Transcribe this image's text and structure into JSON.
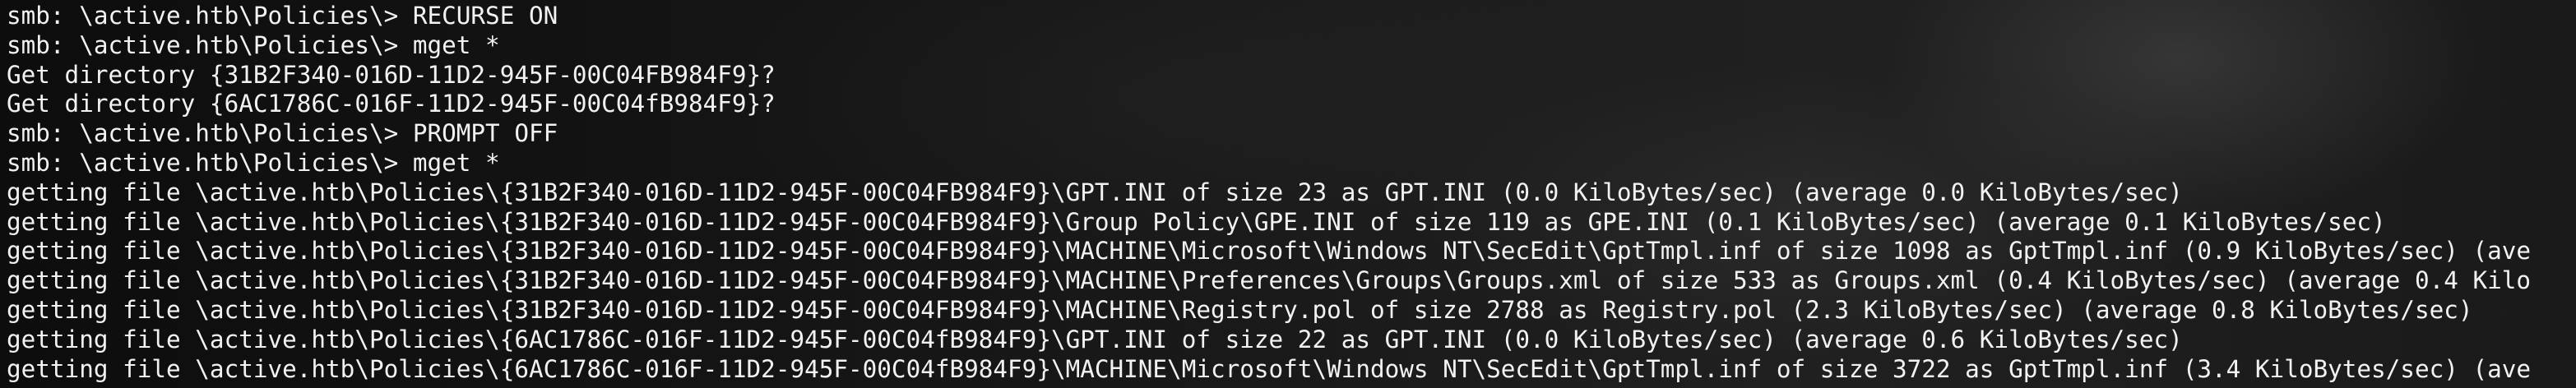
{
  "terminal": {
    "lines": [
      "smb: \\active.htb\\Policies\\> RECURSE ON",
      "smb: \\active.htb\\Policies\\> mget *",
      "Get directory {31B2F340-016D-11D2-945F-00C04FB984F9}?",
      "Get directory {6AC1786C-016F-11D2-945F-00C04fB984F9}?",
      "smb: \\active.htb\\Policies\\> PROMPT OFF",
      "smb: \\active.htb\\Policies\\> mget *",
      "getting file \\active.htb\\Policies\\{31B2F340-016D-11D2-945F-00C04FB984F9}\\GPT.INI of size 23 as GPT.INI (0.0 KiloBytes/sec) (average 0.0 KiloBytes/sec)",
      "getting file \\active.htb\\Policies\\{31B2F340-016D-11D2-945F-00C04FB984F9}\\Group Policy\\GPE.INI of size 119 as GPE.INI (0.1 KiloBytes/sec) (average 0.1 KiloBytes/sec)",
      "getting file \\active.htb\\Policies\\{31B2F340-016D-11D2-945F-00C04FB984F9}\\MACHINE\\Microsoft\\Windows NT\\SecEdit\\GptTmpl.inf of size 1098 as GptTmpl.inf (0.9 KiloBytes/sec) (ave",
      "getting file \\active.htb\\Policies\\{31B2F340-016D-11D2-945F-00C04FB984F9}\\MACHINE\\Preferences\\Groups\\Groups.xml of size 533 as Groups.xml (0.4 KiloBytes/sec) (average 0.4 Kilo",
      "getting file \\active.htb\\Policies\\{31B2F340-016D-11D2-945F-00C04FB984F9}\\MACHINE\\Registry.pol of size 2788 as Registry.pol (2.3 KiloBytes/sec) (average 0.8 KiloBytes/sec)",
      "getting file \\active.htb\\Policies\\{6AC1786C-016F-11D2-945F-00C04fB984F9}\\GPT.INI of size 22 as GPT.INI (0.0 KiloBytes/sec) (average 0.6 KiloBytes/sec)",
      "getting file \\active.htb\\Policies\\{6AC1786C-016F-11D2-945F-00C04fB984F9}\\MACHINE\\Microsoft\\Windows NT\\SecEdit\\GptTmpl.inf of size 3722 as GptTmpl.inf (3.4 KiloBytes/sec) (ave"
    ]
  }
}
